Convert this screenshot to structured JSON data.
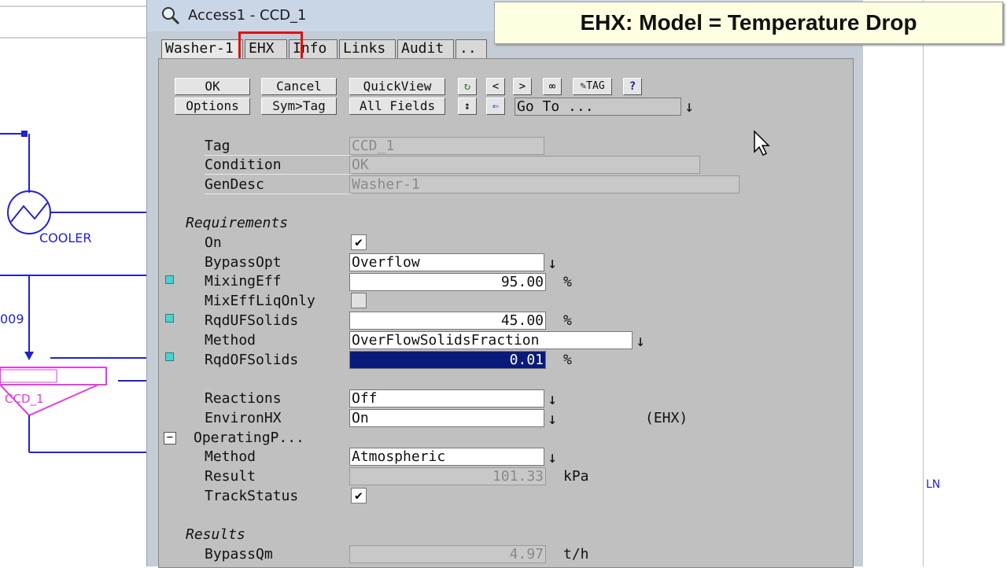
{
  "caption": "EHX: Model = Temperature Drop",
  "window": {
    "title": "Access1 - CCD_1"
  },
  "tabs": [
    "Washer-1",
    "EHX",
    "Info",
    "Links",
    "Audit",
    ".."
  ],
  "toolbar": {
    "ok": "OK",
    "cancel": "Cancel",
    "quickview": "QuickView",
    "options": "Options",
    "symtag": "Sym>Tag",
    "allfields": "All Fields",
    "prev": "<",
    "next": ">",
    "tag_btn": "TAG",
    "help": "?",
    "goto": "Go To ..."
  },
  "header_fields": [
    {
      "label": "Tag",
      "value": "CCD_1"
    },
    {
      "label": "Condition",
      "value": "OK"
    },
    {
      "label": "GenDesc",
      "value": "Washer-1"
    }
  ],
  "requirements": {
    "title": "Requirements",
    "on_label": "On",
    "bypassopt_label": "BypassOpt",
    "bypassopt_value": "Overflow",
    "mixingeff_label": "MixingEff",
    "mixingeff_value": "95.00",
    "mixingeff_unit": "%",
    "mixeffliq_label": "MixEffLiqOnly",
    "rqdufsolids_label": "RqdUFSolids",
    "rqdufsolids_value": "45.00",
    "rqdufsolids_unit": "%",
    "method_label": "Method",
    "method_value": "OverFlowSolidsFraction",
    "rqdofsolids_label": "RqdOFSolids",
    "rqdofsolids_value": "0.01",
    "rqdofsolids_unit": "%",
    "reactions_label": "Reactions",
    "reactions_value": "Off",
    "environhx_label": "EnvironHX",
    "environhx_value": "On",
    "environhx_note": "(EHX)",
    "operatingp_label": "OperatingP...",
    "op_method_label": "Method",
    "op_method_value": "Atmospheric",
    "result_label": "Result",
    "result_value": "101.33",
    "result_unit": "kPa",
    "trackstatus_label": "TrackStatus"
  },
  "results": {
    "title": "Results",
    "bypassqm_label": "BypassQm",
    "bypassqm_value": "4.97",
    "bypassqm_unit": "t/h"
  },
  "flowsheet": {
    "cooler_label": "COOLER",
    "stream_label": "009",
    "unit_label": "CCD_1",
    "right_label": "LN"
  }
}
